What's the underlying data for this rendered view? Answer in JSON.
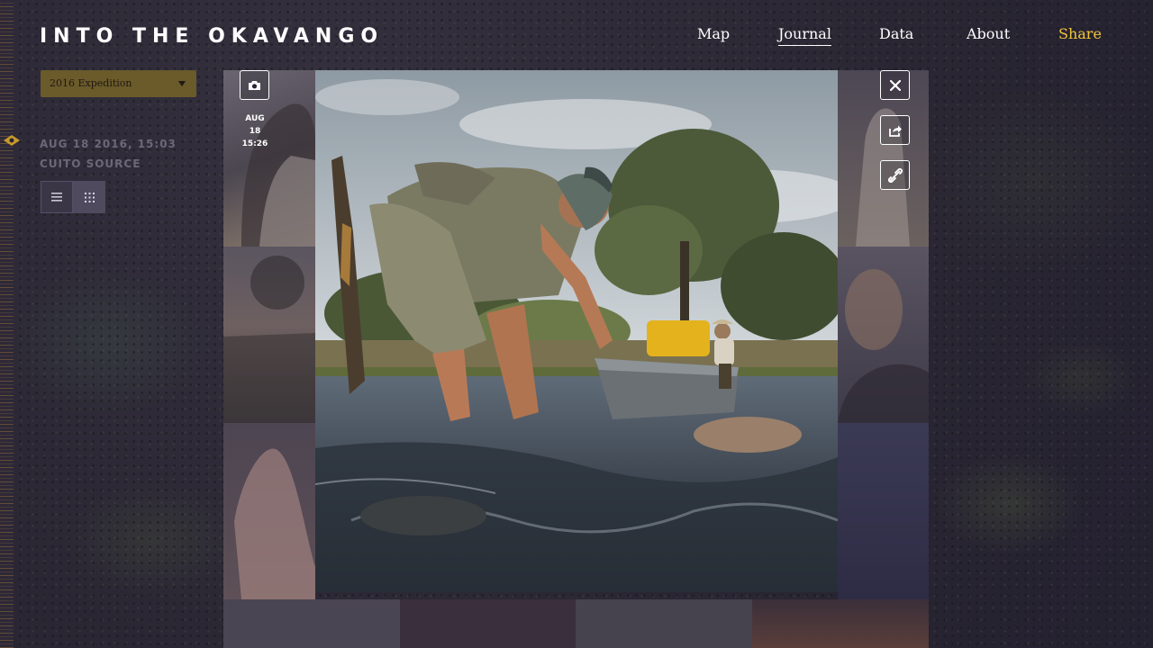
{
  "header": {
    "logo": "INTO THE OKAVANGO",
    "nav": [
      {
        "label": "Map"
      },
      {
        "label": "Journal"
      },
      {
        "label": "Data"
      },
      {
        "label": "About"
      },
      {
        "label": "Share"
      }
    ],
    "active_nav": "Journal",
    "share_color": "#f2c53d"
  },
  "sidebar": {
    "expedition_select": "2016 Expedition",
    "date_line": "AUG 18 2016, 15:03",
    "location_line": "CUITO SOURCE",
    "view_toggle": {
      "list_icon": "list-icon",
      "grid_icon": "grid-icon"
    }
  },
  "viewer": {
    "media_type_icon": "camera-icon",
    "date": "AUG 18",
    "time": "15:26",
    "actions": [
      "close-icon",
      "share-icon",
      "link-icon"
    ]
  }
}
